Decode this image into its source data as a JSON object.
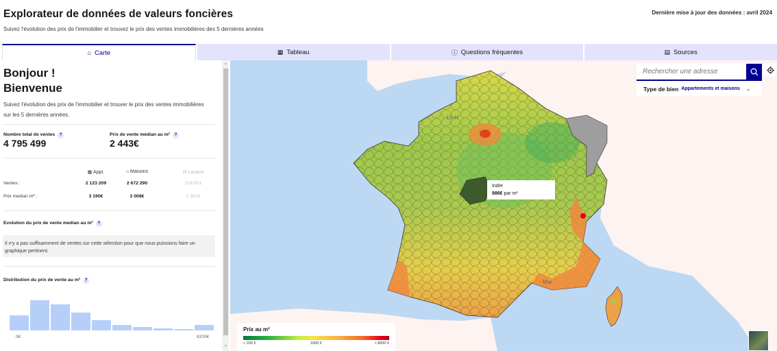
{
  "header": {
    "title": "Explorateur de données de valeurs foncières",
    "subtitle": "Suivez l'évolution des prix de l'immobilier et trouvez le prix des ventes immobilières des 5 dernières années",
    "update_note": "Dernière mise à jour des données : avril 2024"
  },
  "tabs": [
    {
      "label": "Carte",
      "icon": "home-icon",
      "glyph": "⌂",
      "active": true
    },
    {
      "label": "Tableau",
      "icon": "table-icon",
      "glyph": "▦",
      "active": false
    },
    {
      "label": "Questions fréquentes",
      "icon": "info-icon",
      "glyph": "ⓘ",
      "active": false
    },
    {
      "label": "Sources",
      "icon": "book-icon",
      "glyph": "▤",
      "active": false
    }
  ],
  "sidebar": {
    "greeting_line1": "Bonjour !",
    "greeting_line2": "Bienvenue",
    "intro": "Suivez l'évolution des prix de l'immobilier et trouver le prix des ventes immobilières sur les 5 dernières années.",
    "kpis": [
      {
        "label": "Nombre total de ventes",
        "value": "4 795 499",
        "help": "?"
      },
      {
        "label": "Prix de vente médian au m²",
        "value": "2 443€",
        "help": "?"
      }
    ],
    "breakdown": {
      "columns": [
        {
          "label": "Appt.",
          "glyph": "▦",
          "icon": "building-icon",
          "muted": false
        },
        {
          "label": "Maisons",
          "glyph": "⌂",
          "icon": "house-icon",
          "muted": false
        },
        {
          "label": "Locaux",
          "glyph": "⊟",
          "icon": "store-icon",
          "muted": true
        }
      ],
      "rows": [
        {
          "label": "Ventes :",
          "values": [
            "2 123 209",
            "2 672 290",
            "216 651"
          ]
        },
        {
          "label": "Prix median m² :",
          "values": [
            "3 190€",
            "2 008€",
            "1 352€"
          ]
        }
      ]
    },
    "evolution": {
      "title": "Evolution du prix de vente median au m²",
      "help": "?",
      "notice": "Il n'y a pas suffisamment de ventes sur cette sélection pour que nous puissions faire un graphique pertinent."
    },
    "distribution": {
      "title": "Distribution du prix de vente au m²",
      "help": "?",
      "axis_min": "0€",
      "axis_max": "8200€",
      "bins_relative": [
        0.51,
        1.0,
        0.86,
        0.58,
        0.35,
        0.18,
        0.12,
        0.07,
        0.04,
        0.18
      ]
    }
  },
  "map": {
    "search_placeholder": "Rechercher une adresse",
    "type_label": "Type de bien",
    "type_value": "Appartements et maisons",
    "tooltip": {
      "name": "Indre",
      "price": "986€",
      "unit": " par m²"
    },
    "city_labels": [
      "Le H",
      "Mar"
    ],
    "legend": {
      "title": "Prix au m²",
      "min_label": "< 200 €",
      "mid_label": "1600 €",
      "max_label": "> 8000 €"
    },
    "colors": {
      "sea": "#bdd8f2",
      "land": "#fdf3f0",
      "accent": "#000091"
    }
  }
}
